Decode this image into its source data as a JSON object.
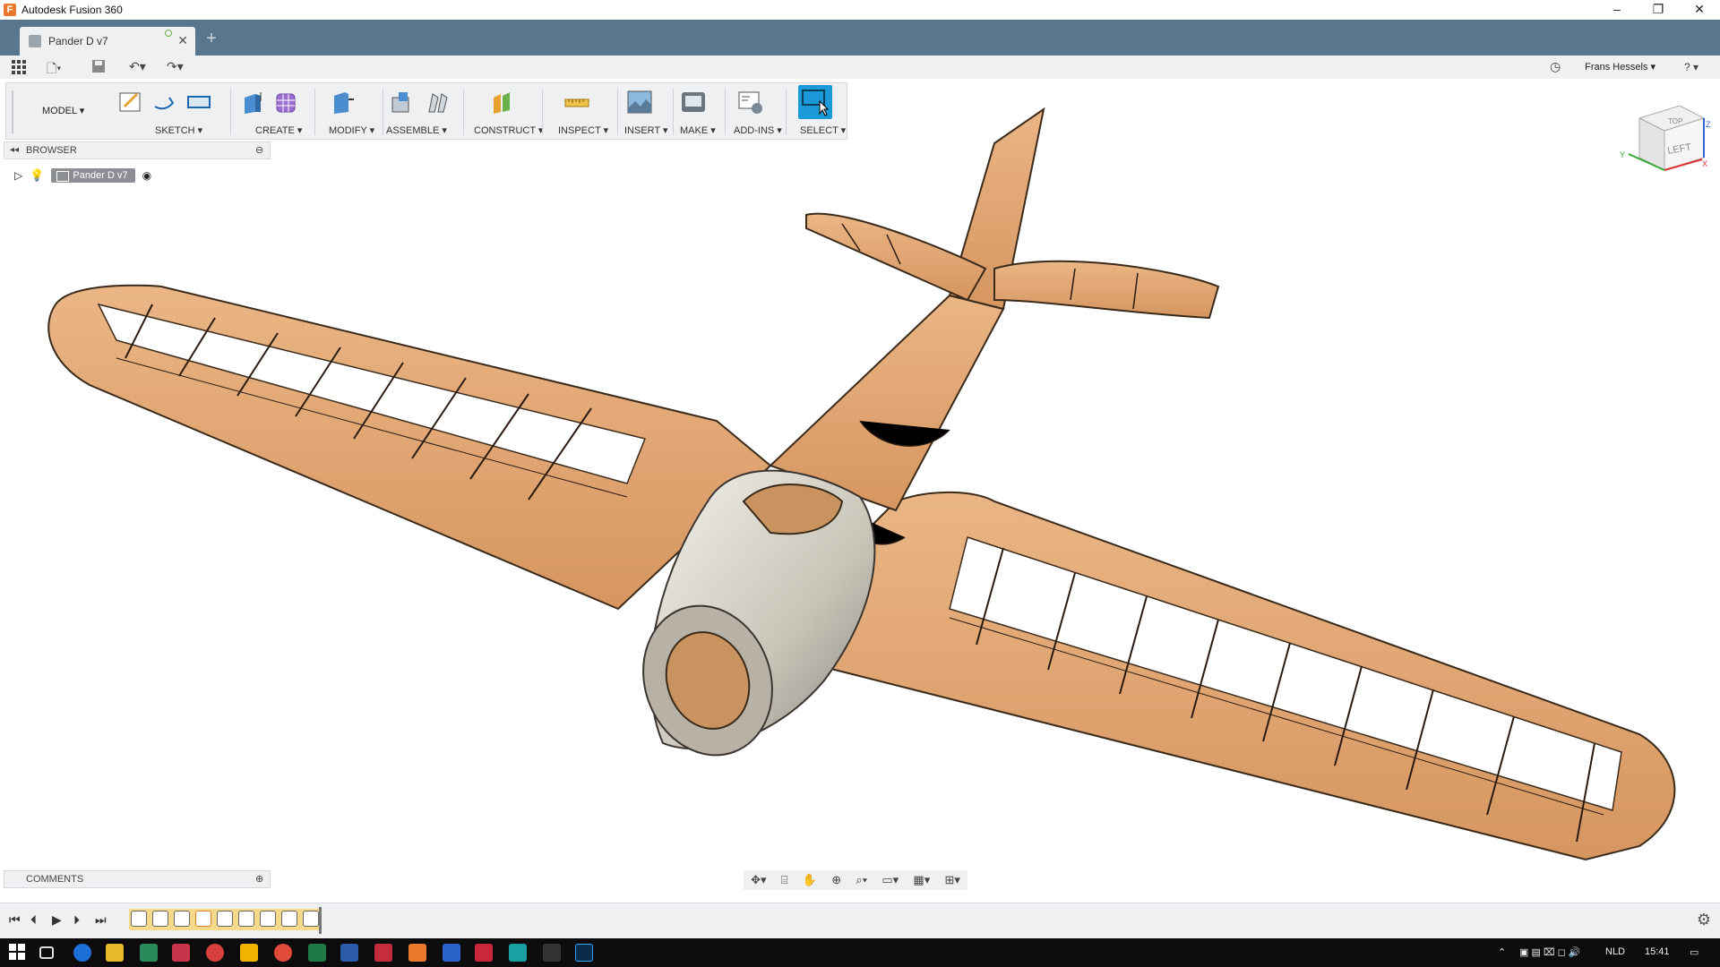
{
  "window": {
    "title": "Autodesk Fusion 360",
    "app_letter": "F"
  },
  "tabs": {
    "active_label": "Pander D v7",
    "new_tab": "+"
  },
  "quickbar": {
    "user_name": "Frans Hessels ▾",
    "help": "? ▾"
  },
  "toolbar": {
    "workspace": "MODEL ▾",
    "groups": [
      {
        "label": "SKETCH ▾"
      },
      {
        "label": "CREATE ▾"
      },
      {
        "label": "MODIFY ▾"
      },
      {
        "label": "ASSEMBLE ▾"
      },
      {
        "label": "CONSTRUCT ▾"
      },
      {
        "label": "INSPECT ▾"
      },
      {
        "label": "INSERT ▾"
      },
      {
        "label": "MAKE ▾"
      },
      {
        "label": "ADD-INS ▾"
      },
      {
        "label": "SELECT ▾"
      }
    ]
  },
  "browser": {
    "title": "BROWSER",
    "root_node": "Pander D v7"
  },
  "viewcube": {
    "face": "LEFT",
    "top": "TOP",
    "axis_z": "Z",
    "axis_x": "X",
    "axis_y": "Y"
  },
  "comments": {
    "title": "COMMENTS"
  },
  "taskbar": {
    "language": "NLD",
    "time": "15:41"
  },
  "colors": {
    "tabbar": "#5a768f",
    "accent": "#1a9ad6",
    "balsa": "#e2a46e"
  }
}
